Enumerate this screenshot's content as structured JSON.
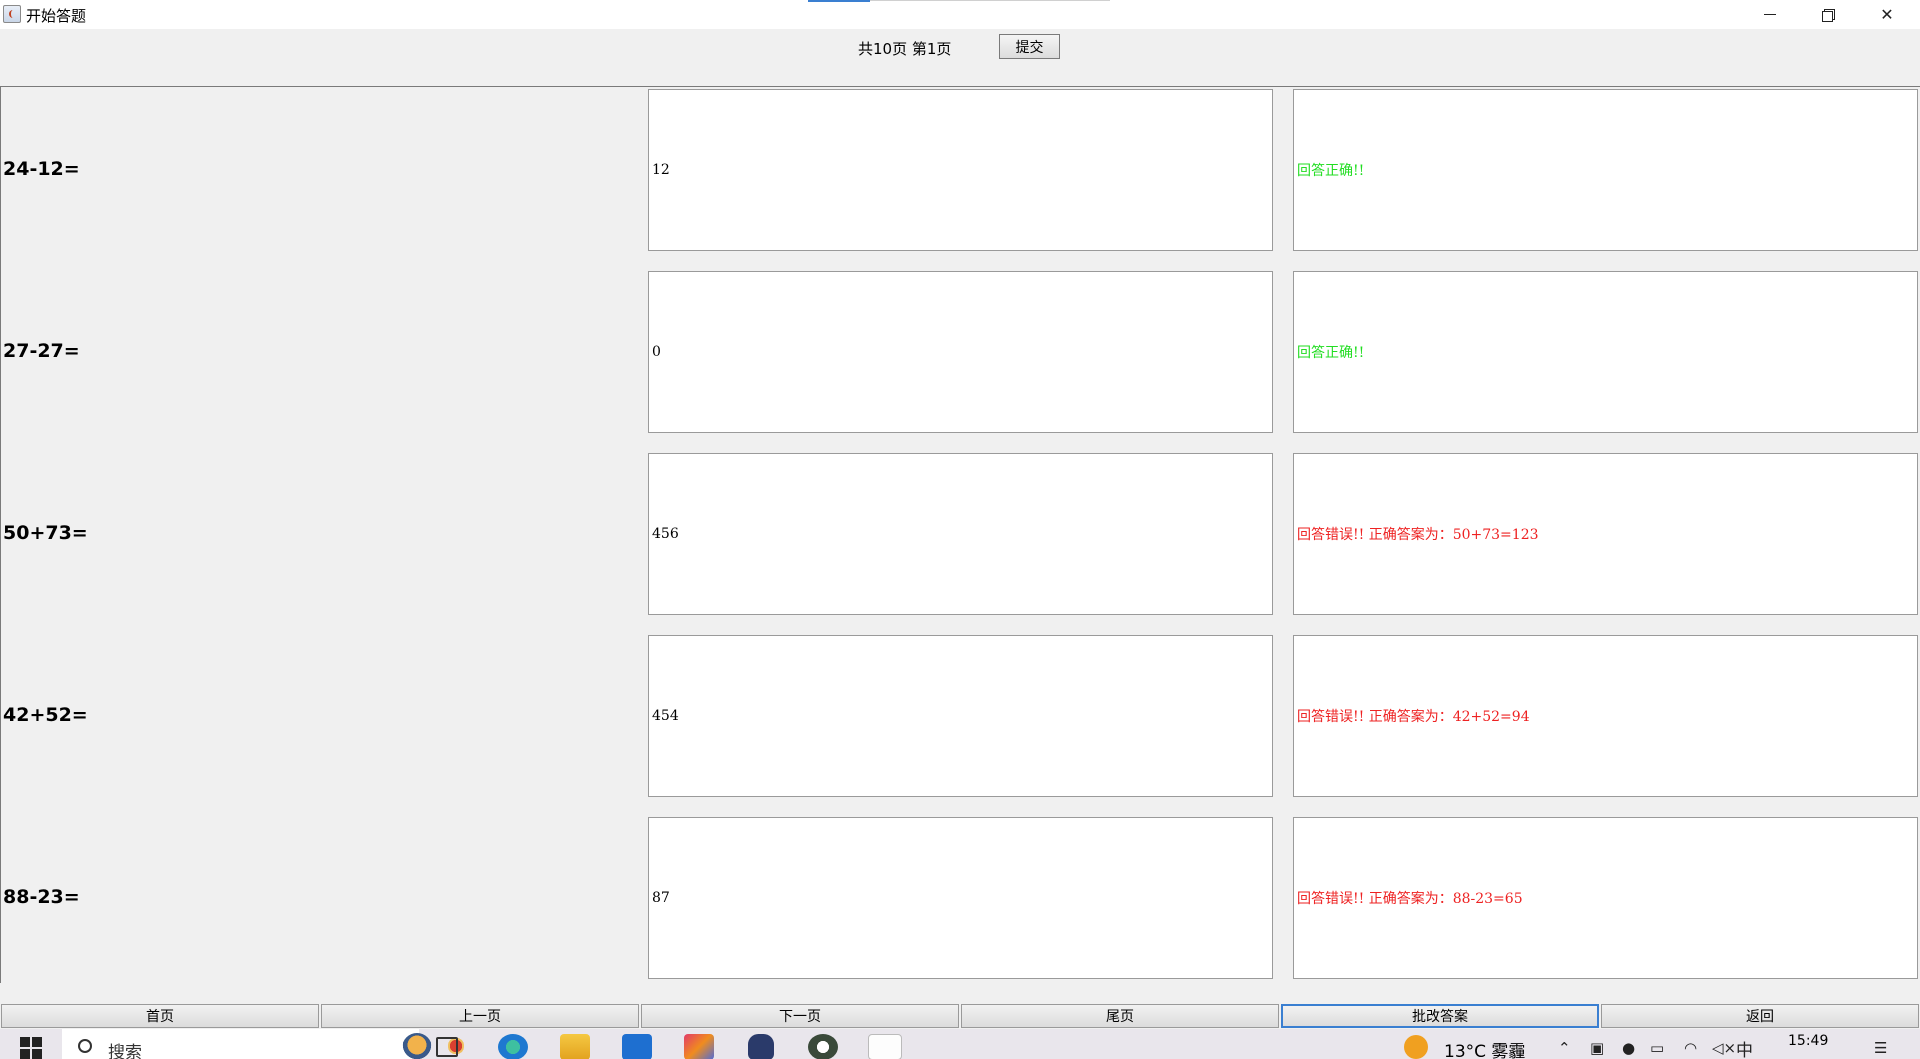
{
  "window": {
    "title": "开始答题"
  },
  "header": {
    "page_info": "共10页 第1页",
    "submit_label": "提交"
  },
  "questions": [
    {
      "expr": "24-12=",
      "answer": "12",
      "result": "回答正确!!",
      "correct": true
    },
    {
      "expr": "27-27=",
      "answer": "0",
      "result": "回答正确!!",
      "correct": true
    },
    {
      "expr": "50+73=",
      "answer": "456",
      "result": "回答错误!! 正确答案为：50+73=123",
      "correct": false
    },
    {
      "expr": "42+52=",
      "answer": "454",
      "result": "回答错误!! 正确答案为：42+52=94",
      "correct": false
    },
    {
      "expr": "88-23=",
      "answer": "87",
      "result": "回答错误!! 正确答案为：88-23=65",
      "correct": false
    }
  ],
  "nav": {
    "first": "首页",
    "prev": "上一页",
    "next": "下一页",
    "last": "尾页",
    "grade": "批改答案",
    "back": "返回"
  },
  "taskbar": {
    "search_text": "搜索",
    "weather": "13°C 雾霾",
    "ime": "中",
    "time": "15:49"
  },
  "colors": {
    "correct": "#22dd22",
    "wrong": "#ee2222",
    "focus": "#3a7fd1"
  }
}
